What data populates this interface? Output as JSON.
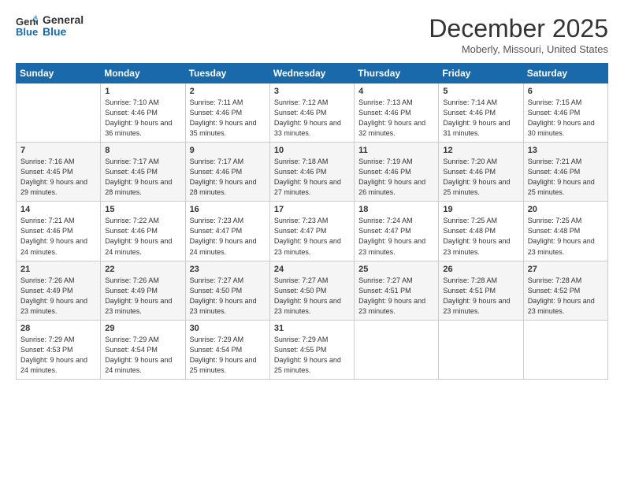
{
  "logo": {
    "line1": "General",
    "line2": "Blue"
  },
  "title": "December 2025",
  "location": "Moberly, Missouri, United States",
  "days_header": [
    "Sunday",
    "Monday",
    "Tuesday",
    "Wednesday",
    "Thursday",
    "Friday",
    "Saturday"
  ],
  "weeks": [
    [
      {
        "num": "",
        "sunrise": "",
        "sunset": "",
        "daylight": ""
      },
      {
        "num": "1",
        "sunrise": "Sunrise: 7:10 AM",
        "sunset": "Sunset: 4:46 PM",
        "daylight": "Daylight: 9 hours and 36 minutes."
      },
      {
        "num": "2",
        "sunrise": "Sunrise: 7:11 AM",
        "sunset": "Sunset: 4:46 PM",
        "daylight": "Daylight: 9 hours and 35 minutes."
      },
      {
        "num": "3",
        "sunrise": "Sunrise: 7:12 AM",
        "sunset": "Sunset: 4:46 PM",
        "daylight": "Daylight: 9 hours and 33 minutes."
      },
      {
        "num": "4",
        "sunrise": "Sunrise: 7:13 AM",
        "sunset": "Sunset: 4:46 PM",
        "daylight": "Daylight: 9 hours and 32 minutes."
      },
      {
        "num": "5",
        "sunrise": "Sunrise: 7:14 AM",
        "sunset": "Sunset: 4:46 PM",
        "daylight": "Daylight: 9 hours and 31 minutes."
      },
      {
        "num": "6",
        "sunrise": "Sunrise: 7:15 AM",
        "sunset": "Sunset: 4:46 PM",
        "daylight": "Daylight: 9 hours and 30 minutes."
      }
    ],
    [
      {
        "num": "7",
        "sunrise": "Sunrise: 7:16 AM",
        "sunset": "Sunset: 4:45 PM",
        "daylight": "Daylight: 9 hours and 29 minutes."
      },
      {
        "num": "8",
        "sunrise": "Sunrise: 7:17 AM",
        "sunset": "Sunset: 4:45 PM",
        "daylight": "Daylight: 9 hours and 28 minutes."
      },
      {
        "num": "9",
        "sunrise": "Sunrise: 7:17 AM",
        "sunset": "Sunset: 4:46 PM",
        "daylight": "Daylight: 9 hours and 28 minutes."
      },
      {
        "num": "10",
        "sunrise": "Sunrise: 7:18 AM",
        "sunset": "Sunset: 4:46 PM",
        "daylight": "Daylight: 9 hours and 27 minutes."
      },
      {
        "num": "11",
        "sunrise": "Sunrise: 7:19 AM",
        "sunset": "Sunset: 4:46 PM",
        "daylight": "Daylight: 9 hours and 26 minutes."
      },
      {
        "num": "12",
        "sunrise": "Sunrise: 7:20 AM",
        "sunset": "Sunset: 4:46 PM",
        "daylight": "Daylight: 9 hours and 25 minutes."
      },
      {
        "num": "13",
        "sunrise": "Sunrise: 7:21 AM",
        "sunset": "Sunset: 4:46 PM",
        "daylight": "Daylight: 9 hours and 25 minutes."
      }
    ],
    [
      {
        "num": "14",
        "sunrise": "Sunrise: 7:21 AM",
        "sunset": "Sunset: 4:46 PM",
        "daylight": "Daylight: 9 hours and 24 minutes."
      },
      {
        "num": "15",
        "sunrise": "Sunrise: 7:22 AM",
        "sunset": "Sunset: 4:46 PM",
        "daylight": "Daylight: 9 hours and 24 minutes."
      },
      {
        "num": "16",
        "sunrise": "Sunrise: 7:23 AM",
        "sunset": "Sunset: 4:47 PM",
        "daylight": "Daylight: 9 hours and 24 minutes."
      },
      {
        "num": "17",
        "sunrise": "Sunrise: 7:23 AM",
        "sunset": "Sunset: 4:47 PM",
        "daylight": "Daylight: 9 hours and 23 minutes."
      },
      {
        "num": "18",
        "sunrise": "Sunrise: 7:24 AM",
        "sunset": "Sunset: 4:47 PM",
        "daylight": "Daylight: 9 hours and 23 minutes."
      },
      {
        "num": "19",
        "sunrise": "Sunrise: 7:25 AM",
        "sunset": "Sunset: 4:48 PM",
        "daylight": "Daylight: 9 hours and 23 minutes."
      },
      {
        "num": "20",
        "sunrise": "Sunrise: 7:25 AM",
        "sunset": "Sunset: 4:48 PM",
        "daylight": "Daylight: 9 hours and 23 minutes."
      }
    ],
    [
      {
        "num": "21",
        "sunrise": "Sunrise: 7:26 AM",
        "sunset": "Sunset: 4:49 PM",
        "daylight": "Daylight: 9 hours and 23 minutes."
      },
      {
        "num": "22",
        "sunrise": "Sunrise: 7:26 AM",
        "sunset": "Sunset: 4:49 PM",
        "daylight": "Daylight: 9 hours and 23 minutes."
      },
      {
        "num": "23",
        "sunrise": "Sunrise: 7:27 AM",
        "sunset": "Sunset: 4:50 PM",
        "daylight": "Daylight: 9 hours and 23 minutes."
      },
      {
        "num": "24",
        "sunrise": "Sunrise: 7:27 AM",
        "sunset": "Sunset: 4:50 PM",
        "daylight": "Daylight: 9 hours and 23 minutes."
      },
      {
        "num": "25",
        "sunrise": "Sunrise: 7:27 AM",
        "sunset": "Sunset: 4:51 PM",
        "daylight": "Daylight: 9 hours and 23 minutes."
      },
      {
        "num": "26",
        "sunrise": "Sunrise: 7:28 AM",
        "sunset": "Sunset: 4:51 PM",
        "daylight": "Daylight: 9 hours and 23 minutes."
      },
      {
        "num": "27",
        "sunrise": "Sunrise: 7:28 AM",
        "sunset": "Sunset: 4:52 PM",
        "daylight": "Daylight: 9 hours and 23 minutes."
      }
    ],
    [
      {
        "num": "28",
        "sunrise": "Sunrise: 7:29 AM",
        "sunset": "Sunset: 4:53 PM",
        "daylight": "Daylight: 9 hours and 24 minutes."
      },
      {
        "num": "29",
        "sunrise": "Sunrise: 7:29 AM",
        "sunset": "Sunset: 4:54 PM",
        "daylight": "Daylight: 9 hours and 24 minutes."
      },
      {
        "num": "30",
        "sunrise": "Sunrise: 7:29 AM",
        "sunset": "Sunset: 4:54 PM",
        "daylight": "Daylight: 9 hours and 25 minutes."
      },
      {
        "num": "31",
        "sunrise": "Sunrise: 7:29 AM",
        "sunset": "Sunset: 4:55 PM",
        "daylight": "Daylight: 9 hours and 25 minutes."
      },
      {
        "num": "",
        "sunrise": "",
        "sunset": "",
        "daylight": ""
      },
      {
        "num": "",
        "sunrise": "",
        "sunset": "",
        "daylight": ""
      },
      {
        "num": "",
        "sunrise": "",
        "sunset": "",
        "daylight": ""
      }
    ]
  ]
}
